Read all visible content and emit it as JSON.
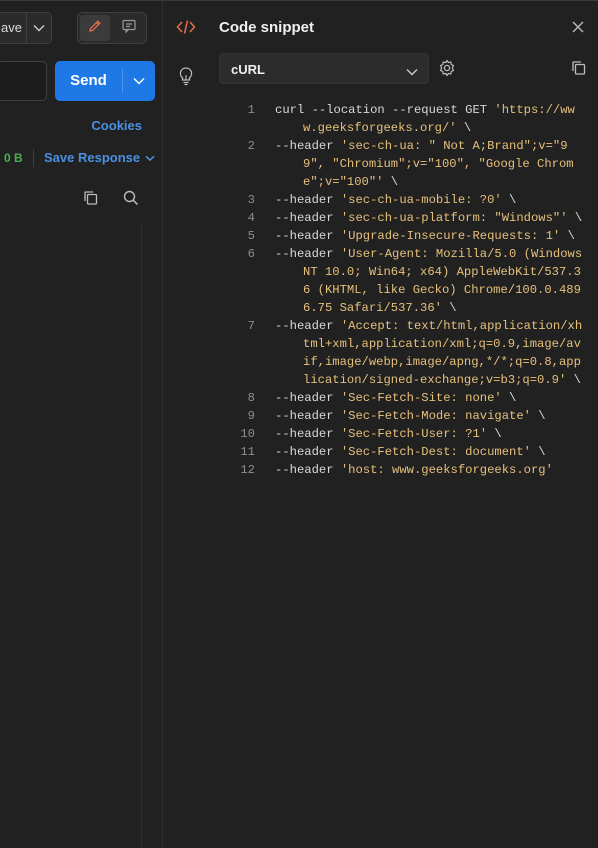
{
  "request_panel": {
    "save_label": "ave",
    "send_label": "Send",
    "cookies_label": "Cookies",
    "response_size": "0 B",
    "save_response_label": "Save Response",
    "icons": [
      "chevron-down-icon",
      "pencil-icon",
      "comment-icon",
      "copy-icon",
      "search-icon"
    ]
  },
  "snippet": {
    "title": "Code snippet",
    "language": "cURL",
    "icons": [
      "code-icon",
      "lightbulb-icon",
      "close-icon",
      "gear-icon",
      "copy-icon",
      "chevron-down-icon"
    ],
    "lines": [
      {
        "n": "1",
        "cmd": "curl --location --request GET ",
        "str": "'https://www.geeksforgeeks.org/'",
        "tail": " \\"
      },
      {
        "n": "2",
        "cmd": "--header ",
        "str": "'sec-ch-ua: \" Not A;Brand\";v=\"99\", \"Chromium\";v=\"100\", \"Google Chrome\";v=\"100\"'",
        "tail": " \\"
      },
      {
        "n": "3",
        "cmd": "--header ",
        "str": "'sec-ch-ua-mobile: ?0'",
        "tail": " \\"
      },
      {
        "n": "4",
        "cmd": "--header ",
        "str": "'sec-ch-ua-platform: \"Windows\"'",
        "tail": " \\"
      },
      {
        "n": "5",
        "cmd": "--header ",
        "str": "'Upgrade-Insecure-Requests: 1'",
        "tail": " \\"
      },
      {
        "n": "6",
        "cmd": "--header ",
        "str": "'User-Agent: Mozilla/5.0 (Windows NT 10.0; Win64; x64) AppleWebKit/537.36 (KHTML, like Gecko) Chrome/100.0.4896.75 Safari/537.36'",
        "tail": " \\"
      },
      {
        "n": "7",
        "cmd": "--header ",
        "str": "'Accept: text/html,application/xhtml+xml,application/xml;q=0.9,image/avif,image/webp,image/apng,*/*;q=0.8,application/signed-exchange;v=b3;q=0.9'",
        "tail": " \\"
      },
      {
        "n": "8",
        "cmd": "--header ",
        "str": "'Sec-Fetch-Site: none'",
        "tail": " \\"
      },
      {
        "n": "9",
        "cmd": "--header ",
        "str": "'Sec-Fetch-Mode: navigate'",
        "tail": " \\"
      },
      {
        "n": "10",
        "cmd": "--header ",
        "str": "'Sec-Fetch-User: ?1'",
        "tail": " \\"
      },
      {
        "n": "11",
        "cmd": "--header ",
        "str": "'Sec-Fetch-Dest: document'",
        "tail": " \\"
      },
      {
        "n": "12",
        "cmd": "--header ",
        "str": "'host: www.geeksforgeeks.org'",
        "tail": ""
      }
    ]
  },
  "colors": {
    "background": "#212121",
    "accent_blue": "#1e78e6",
    "link_blue": "#4a90e2",
    "status_green": "#4caf50",
    "code_icon_orange": "#e8704a",
    "string_yellow": "#e6c07b"
  }
}
